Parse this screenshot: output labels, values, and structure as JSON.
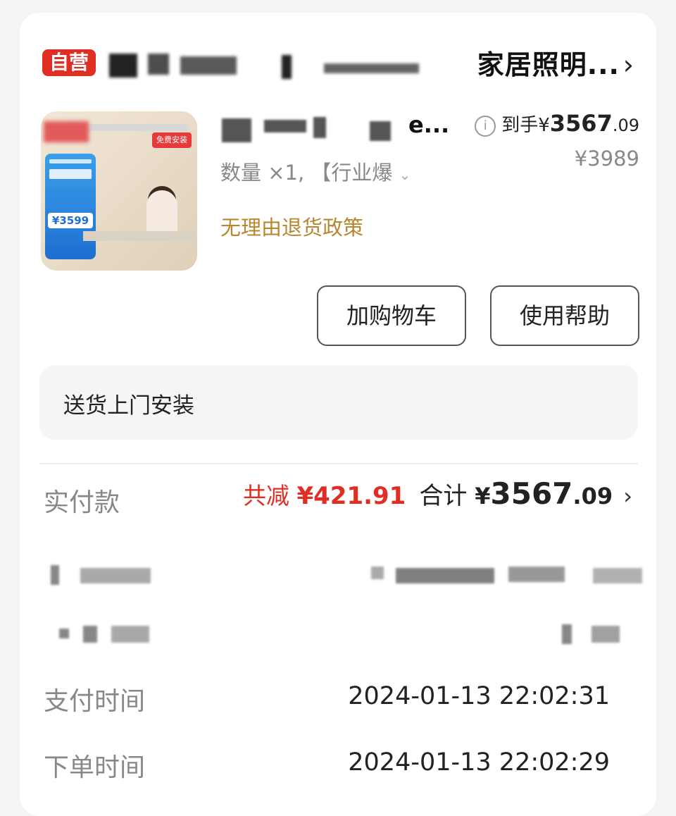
{
  "store": {
    "badge": "自营",
    "name_suffix": "家居照明...",
    "chevron": "›"
  },
  "product": {
    "title_suffix": "e...",
    "spec": "数量 ×1, 【行业爆",
    "spec_chevron": "⌄",
    "policy": "无理由退货政策",
    "thumb_price": "¥3599",
    "thumb_install_tag": "免费安装",
    "price_label": "到手",
    "price_currency": "¥",
    "price_int": "3567",
    "price_dec": ".09",
    "original_price": "¥3989",
    "info_icon": "i"
  },
  "actions": {
    "add_cart": "加购物车",
    "help": "使用帮助"
  },
  "delivery": {
    "label": "送货上门安装"
  },
  "payment": {
    "label": "实付款",
    "reduce_prefix": "共减",
    "reduce_amount": "¥421.91",
    "total_prefix": "合计",
    "total_currency": "¥",
    "total_int": "3567",
    "total_dec": ".09",
    "chevron": "›"
  },
  "details": [
    {
      "label": "支付时间",
      "value": "2024-01-13 22:02:31"
    },
    {
      "label": "下单时间",
      "value": "2024-01-13 22:02:29"
    }
  ]
}
